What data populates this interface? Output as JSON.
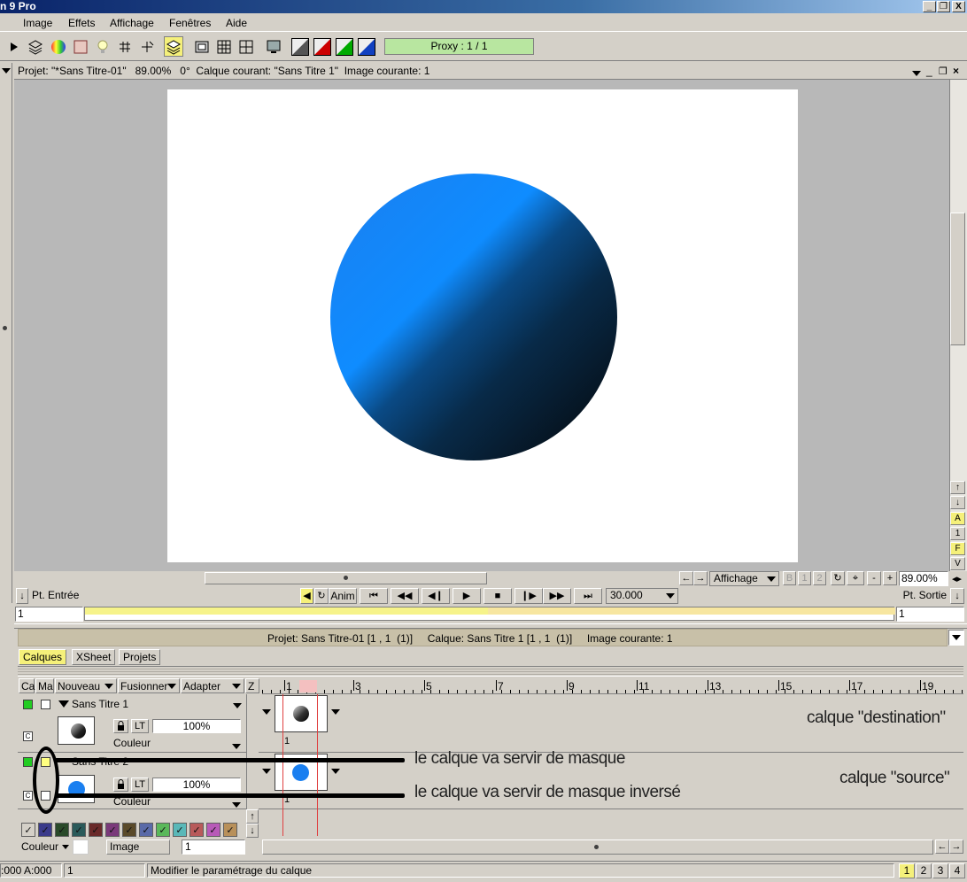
{
  "window": {
    "title": "n 9 Pro",
    "min": "_",
    "max": "❐",
    "close": "X"
  },
  "menu": [
    "Image",
    "Effets",
    "Affichage",
    "Fenêtres",
    "Aide"
  ],
  "toolbar": {
    "proxy": "Proxy : 1 / 1"
  },
  "project_header": "Projet: \"*Sans Titre-01\"   89.00%   0°  Calque courant: \"Sans Titre 1\"  Image courante: 1",
  "view_controls": {
    "affichage": "Affichage",
    "zoom": "89.00%",
    "btn_1": "1",
    "btn_2": "2",
    "minus": "-",
    "plus": "+"
  },
  "side_buttons": [
    "A",
    "1",
    "F",
    "V"
  ],
  "transport": {
    "pt_entree": "Pt. Entrée",
    "pt_sortie": "Pt. Sortie",
    "anim": "Anim",
    "fps": "30.000",
    "in_value": "1",
    "out_value": "1"
  },
  "layer_panel": {
    "header": "Projet: Sans Titre-01 [1 , 1  (1)]     Calque: Sans Titre 1 [1 , 1  (1)]     Image courante: 1",
    "tabs": [
      "Calques",
      "XSheet",
      "Projets"
    ],
    "columns": {
      "ca": "Ca",
      "ma": "Ma",
      "nouveau": "Nouveau",
      "fusionner": "Fusionner",
      "adapter": "Adapter",
      "z": "Z"
    },
    "ruler": [
      "1",
      "3",
      "5",
      "7",
      "9",
      "11",
      "13",
      "15",
      "17",
      "19"
    ],
    "layers": [
      {
        "name": "Sans Titre 1",
        "opacity": "100%",
        "mode": "Couleur",
        "lt": "LT",
        "c": "C",
        "frame": "1"
      },
      {
        "name": "Sans Titre 2",
        "opacity": "100%",
        "mode": "Couleur",
        "lt": "LT",
        "c": "C",
        "frame": "1"
      }
    ]
  },
  "annotations": {
    "destination": "calque \"destination\"",
    "source": "calque \"source\"",
    "mask": "le calque va servir de masque",
    "inverse_mask": "le calque va servir de masque inversé"
  },
  "color_swatches": [
    "#d4d0c8",
    "#3a3a8a",
    "#2a4a2a",
    "#2a5a5a",
    "#6a2a2a",
    "#7a3a7a",
    "#5a4a2a",
    "#5a6aa8",
    "#5ab85a",
    "#5ab8b8",
    "#b85a5a",
    "#b85ab8",
    "#b8905a"
  ],
  "bottom_row": {
    "couleur": "Couleur",
    "image": "Image",
    "value": "1"
  },
  "status": {
    "coords": ":000 A:000",
    "frame": "1",
    "message": "Modifier le paramétrage du calque",
    "pages": [
      "1",
      "2",
      "3",
      "4"
    ]
  }
}
